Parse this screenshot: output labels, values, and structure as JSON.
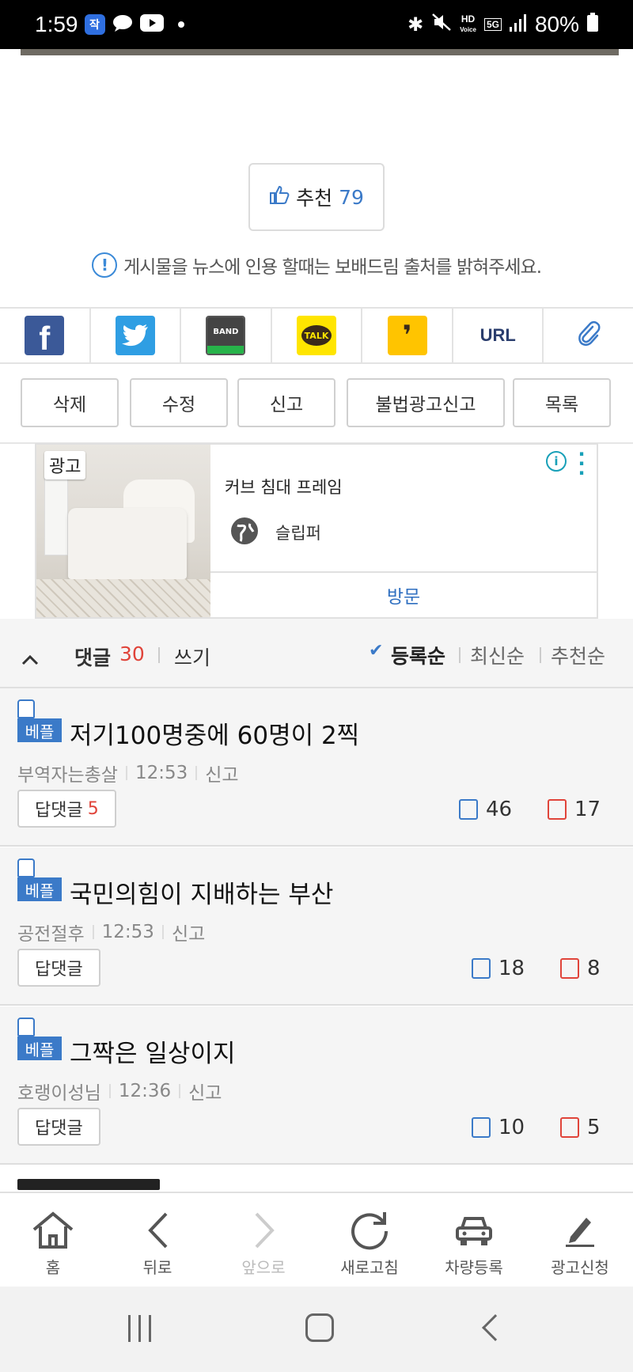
{
  "status_bar": {
    "time": "1:59",
    "app_badge": "작",
    "battery": "80%",
    "hd_label": "HD",
    "voice_label": "Voice",
    "net_label": "5G"
  },
  "recommend": {
    "label": "추천",
    "count": "79"
  },
  "notice": "게시물을 뉴스에 인용 할때는 보배드림 출처를 밝혀주세요.",
  "share": {
    "facebook": "f",
    "band": "BAND",
    "kakao": "TALK",
    "url": "URL",
    "icons": [
      "facebook-icon",
      "twitter-icon",
      "band-icon",
      "kakaotalk-icon",
      "kakaostory-icon",
      "url-icon",
      "attachment-icon"
    ]
  },
  "actions": {
    "delete": "삭제",
    "edit": "수정",
    "report": "신고",
    "illegal_ad_report": "불법광고신고",
    "list": "목록"
  },
  "ad": {
    "badge": "광고",
    "title": "커브 침대 프레임",
    "advertiser": "슬립퍼",
    "visit": "방문"
  },
  "comments_header": {
    "title": "댓글",
    "count": "30",
    "write": "쓰기",
    "sort_registered": "등록순",
    "sort_latest": "최신순",
    "sort_recommended": "추천순"
  },
  "comments": [
    {
      "best_tag": "베플",
      "text": "저기100명중에 60명이 2찍",
      "author": "부역자는총살",
      "time": "12:53",
      "report": "신고",
      "reply_label": "답댓글",
      "reply_count": "5",
      "up": "46",
      "down": "17"
    },
    {
      "best_tag": "베플",
      "text": "국민의힘이 지배하는 부산",
      "author": "공전절후",
      "time": "12:53",
      "report": "신고",
      "reply_label": "답댓글",
      "reply_count": "",
      "up": "18",
      "down": "8"
    },
    {
      "best_tag": "베플",
      "text": "그짝은 일상이지",
      "author": "호랭이성님",
      "time": "12:36",
      "report": "신고",
      "reply_label": "답댓글",
      "reply_count": "",
      "up": "10",
      "down": "5"
    }
  ],
  "bottom_nav": {
    "home": "홈",
    "back": "뒤로",
    "forward": "앞으로",
    "refresh": "새로고침",
    "car_register": "차량등록",
    "ad_apply": "광고신청"
  }
}
